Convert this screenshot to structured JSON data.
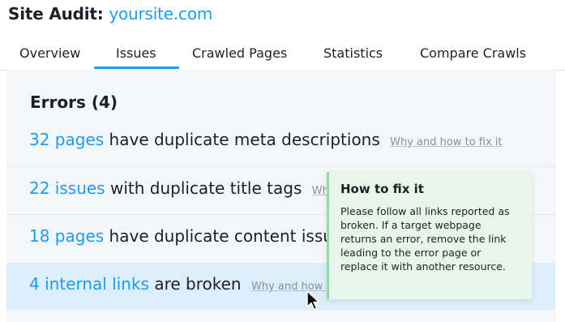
{
  "header": {
    "title_prefix": "Site Audit:",
    "domain": "yoursite.com"
  },
  "tabs": [
    {
      "label": "Overview",
      "active": false
    },
    {
      "label": "Issues",
      "active": true
    },
    {
      "label": "Crawled Pages",
      "active": false
    },
    {
      "label": "Statistics",
      "active": false
    },
    {
      "label": "Compare Crawls",
      "active": false
    }
  ],
  "errors": {
    "title": "Errors (4)",
    "issues": [
      {
        "link": "32 pages",
        "text": "have duplicate meta descriptions",
        "help": "Why and how to fix it"
      },
      {
        "link": "22 issues",
        "text": "with duplicate title tags",
        "help": "Why"
      },
      {
        "link": "18 pages",
        "text": "have duplicate content issu",
        "help": ""
      },
      {
        "link": "4 internal links",
        "text": "are broken",
        "help": "Why and how to"
      }
    ]
  },
  "tooltip": {
    "title": "How to fix it",
    "body": "Please follow all links reported as broken. If a target webpage returns an error, remove the link leading to the error page or replace it with another resource."
  },
  "colors": {
    "accent": "#1d9bf0",
    "row_highlight": "#ddeefb",
    "tooltip_bg": "#e6f7ea",
    "tooltip_border": "#8ce0a7"
  }
}
